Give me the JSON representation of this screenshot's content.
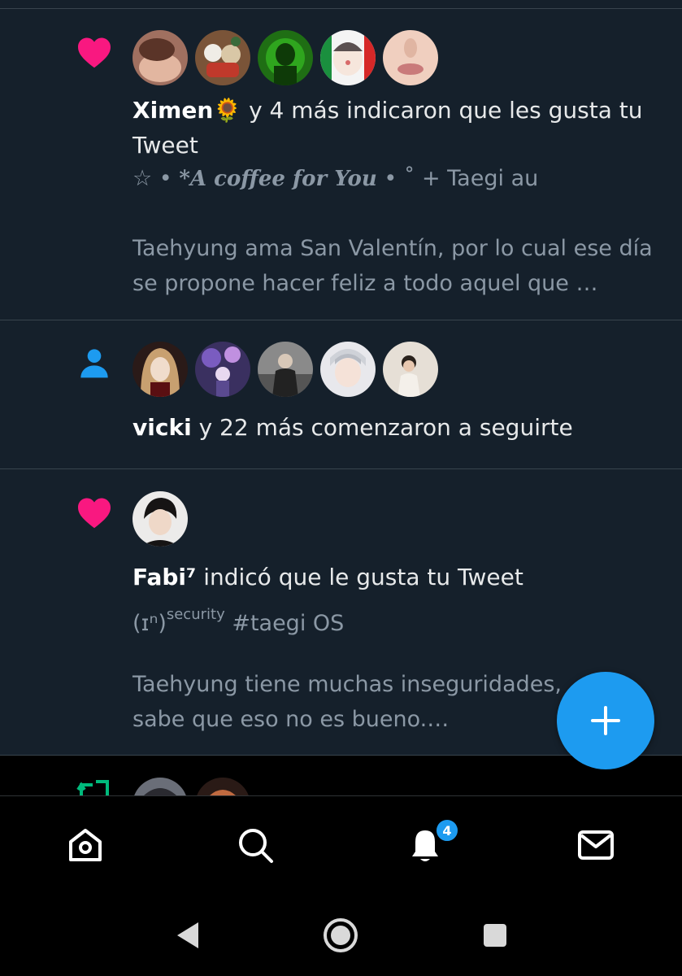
{
  "notifications": [
    {
      "kind_icon": "heart-icon",
      "user": "Ximen",
      "user_emoji": "🌻",
      "action": " y 4 más indicaron que les gusta tu Tweet",
      "tweet_title_star": "☆",
      "tweet_title_pre": " • ",
      "tweet_title_italic": "*A coffee for You",
      "tweet_title_post": " • ˚  + Taegi au",
      "tweet_excerpt": "Taehyung ama San Valentín, por lo cual ese día se propone hacer feliz a todo aquel que …"
    },
    {
      "kind_icon": "person-icon",
      "user": "vicki",
      "action": " y 22 más comenzaron a seguirte"
    },
    {
      "kind_icon": "heart-icon",
      "user": "Fabi⁷",
      "action": " indicó que le gusta tu Tweet",
      "tweet_title_a": "(ɪⁿ)",
      "tweet_title_sup": "security",
      "tweet_title_b": " #taegi OS",
      "tweet_excerpt": "Taehyung tiene muchas inseguridades, sabe que eso no es bueno.…"
    },
    {
      "kind_icon": "retweet-icon"
    }
  ],
  "fab": {
    "icon": "plus-icon",
    "color": "#1d9bf0"
  },
  "tabbar": {
    "items": [
      "home-icon",
      "search-icon",
      "bell-icon",
      "mail-icon"
    ],
    "notifications_badge": "4"
  },
  "system_nav": [
    "back-icon",
    "home-circle-icon",
    "recents-icon"
  ],
  "colors": {
    "background": "#15202b",
    "like": "#f91880",
    "follow": "#1d9bf0",
    "retweet": "#00ba7c",
    "secondary_text": "#8b98a5",
    "divider": "#38444d"
  }
}
